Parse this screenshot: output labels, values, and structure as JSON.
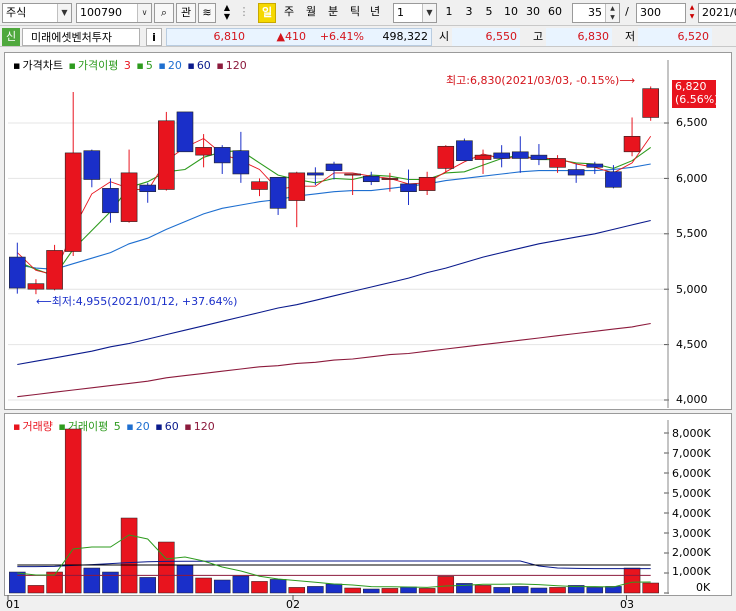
{
  "toolbar": {
    "market": "주식",
    "code": "100790",
    "btn_search": "🔍",
    "btn_watch": "관",
    "period_active": "일",
    "periods": [
      "주",
      "월",
      "분",
      "틱",
      "년"
    ],
    "unit_select": "1",
    "quick_counts": [
      "1",
      "3",
      "5",
      "10",
      "30",
      "60"
    ],
    "view_count": "35",
    "slash": "/",
    "total_count": "300",
    "date": "2021/0"
  },
  "info": {
    "credit_badge": "신",
    "company": "미래에셋벤처투자",
    "info_icon": "i",
    "price": "6,810",
    "change": "▲410",
    "change_pct": "+6.41%",
    "volume": "498,322",
    "open_label": "시",
    "open": "6,550",
    "high_label": "고",
    "high": "6,830",
    "low_label": "저",
    "low": "6,520"
  },
  "price_legend": {
    "title": "가격차트",
    "ma_name": "가격이평",
    "periods": [
      "3",
      "5",
      "20",
      "60",
      "120"
    ]
  },
  "volume_legend": {
    "title": "거래량",
    "ma_name": "거래이평",
    "periods": [
      "5",
      "20",
      "60",
      "120"
    ]
  },
  "annotations": {
    "max": "최고:6,830(2021/03/03, -0.15%)",
    "min": "최저:4,955(2021/01/12, +37.64%)",
    "last_price": "6,820",
    "last_pct": "(6.56%)"
  },
  "price_axis": [
    "6,500",
    "6,000",
    "5,500",
    "5,000",
    "4,500",
    "4,000"
  ],
  "volume_axis": [
    "8,000K",
    "7,000K",
    "6,000K",
    "5,000K",
    "4,000K",
    "3,000K",
    "2,000K",
    "1,000K",
    "0K"
  ],
  "x_axis": [
    "01",
    "02",
    "03"
  ],
  "colors": {
    "up": "#e8141e",
    "down": "#1a2fc9",
    "ma3": "#e8141e",
    "ma5": "#2e9b1e",
    "ma20": "#1e6fd0",
    "ma60": "#0a1a8c",
    "ma120": "#8c1a3c"
  },
  "chart_data": {
    "type": "candlestick",
    "y_range": [
      3900,
      6900
    ],
    "candles": [
      {
        "o": 5290,
        "h": 5420,
        "l": 4960,
        "c": 5010
      },
      {
        "o": 5000,
        "h": 5090,
        "l": 4955,
        "c": 5050
      },
      {
        "o": 5000,
        "h": 5400,
        "l": 4990,
        "c": 5350
      },
      {
        "o": 5340,
        "h": 6780,
        "l": 5300,
        "c": 6230
      },
      {
        "o": 6250,
        "h": 6260,
        "l": 5920,
        "c": 5990
      },
      {
        "o": 5910,
        "h": 6000,
        "l": 5600,
        "c": 5690
      },
      {
        "o": 5610,
        "h": 6260,
        "l": 5600,
        "c": 6050
      },
      {
        "o": 5940,
        "h": 5960,
        "l": 5780,
        "c": 5880
      },
      {
        "o": 5900,
        "h": 6600,
        "l": 5890,
        "c": 6520
      },
      {
        "o": 6600,
        "h": 6600,
        "l": 6240,
        "c": 6240
      },
      {
        "o": 6210,
        "h": 6400,
        "l": 6100,
        "c": 6280
      },
      {
        "o": 6280,
        "h": 6300,
        "l": 6040,
        "c": 6140
      },
      {
        "o": 6250,
        "h": 6420,
        "l": 5960,
        "c": 6040
      },
      {
        "o": 5900,
        "h": 6000,
        "l": 5840,
        "c": 5970
      },
      {
        "o": 6010,
        "h": 6010,
        "l": 5670,
        "c": 5730
      },
      {
        "o": 5800,
        "h": 6060,
        "l": 5560,
        "c": 6050
      },
      {
        "o": 6050,
        "h": 6100,
        "l": 5940,
        "c": 6030
      },
      {
        "o": 6130,
        "h": 6150,
        "l": 5990,
        "c": 6070
      },
      {
        "o": 6040,
        "h": 6040,
        "l": 5850,
        "c": 6040
      },
      {
        "o": 6020,
        "h": 6060,
        "l": 5940,
        "c": 5970
      },
      {
        "o": 5990,
        "h": 6050,
        "l": 5880,
        "c": 6000
      },
      {
        "o": 5950,
        "h": 6080,
        "l": 5760,
        "c": 5880
      },
      {
        "o": 5890,
        "h": 6060,
        "l": 5850,
        "c": 6010
      },
      {
        "o": 6090,
        "h": 6300,
        "l": 6050,
        "c": 6290
      },
      {
        "o": 6340,
        "h": 6360,
        "l": 6160,
        "c": 6160
      },
      {
        "o": 6170,
        "h": 6260,
        "l": 6040,
        "c": 6210
      },
      {
        "o": 6230,
        "h": 6300,
        "l": 6100,
        "c": 6180
      },
      {
        "o": 6240,
        "h": 6380,
        "l": 6050,
        "c": 6180
      },
      {
        "o": 6210,
        "h": 6310,
        "l": 6120,
        "c": 6170
      },
      {
        "o": 6100,
        "h": 6210,
        "l": 6050,
        "c": 6180
      },
      {
        "o": 6080,
        "h": 6130,
        "l": 5960,
        "c": 6030
      },
      {
        "o": 6130,
        "h": 6150,
        "l": 6040,
        "c": 6100
      },
      {
        "o": 6060,
        "h": 6120,
        "l": 5910,
        "c": 5920
      },
      {
        "o": 6240,
        "h": 6550,
        "l": 6200,
        "c": 6380
      },
      {
        "o": 6550,
        "h": 6830,
        "l": 6520,
        "c": 6810
      }
    ],
    "ma3": [
      5330,
      5170,
      5130,
      5540,
      5860,
      5970,
      5910,
      5890,
      6160,
      6280,
      6360,
      6220,
      6160,
      6080,
      5900,
      5930,
      5930,
      6050,
      6050,
      6020,
      6000,
      5950,
      5960,
      6060,
      6150,
      6220,
      6180,
      6190,
      6180,
      6180,
      6130,
      6100,
      6050,
      6140,
      6380
    ],
    "ma5": [
      5250,
      5180,
      5120,
      5360,
      5530,
      5700,
      5920,
      5970,
      6060,
      6080,
      6190,
      6240,
      6250,
      6140,
      6030,
      5990,
      5960,
      6000,
      5990,
      6030,
      6020,
      5990,
      5990,
      6050,
      6060,
      6120,
      6180,
      6210,
      6170,
      6170,
      6140,
      6130,
      6090,
      6160,
      6280
    ],
    "ma20": [
      5220,
      5190,
      5180,
      5230,
      5280,
      5330,
      5410,
      5460,
      5540,
      5610,
      5680,
      5730,
      5760,
      5790,
      5810,
      5840,
      5860,
      5880,
      5890,
      5890,
      5910,
      5930,
      5950,
      5980,
      6000,
      6020,
      6040,
      6060,
      6070,
      6070,
      6070,
      6070,
      6080,
      6100,
      6130
    ],
    "ma60": [
      4320,
      4350,
      4380,
      4410,
      4440,
      4480,
      4510,
      4550,
      4590,
      4630,
      4670,
      4710,
      4750,
      4790,
      4830,
      4860,
      4900,
      4940,
      4980,
      5020,
      5060,
      5100,
      5150,
      5190,
      5240,
      5290,
      5330,
      5370,
      5410,
      5440,
      5470,
      5500,
      5540,
      5580,
      5620
    ],
    "ma120": [
      4030,
      4050,
      4070,
      4090,
      4110,
      4130,
      4150,
      4170,
      4200,
      4220,
      4240,
      4260,
      4280,
      4300,
      4310,
      4330,
      4340,
      4360,
      4370,
      4390,
      4410,
      4420,
      4440,
      4460,
      4480,
      4500,
      4520,
      4540,
      4560,
      4580,
      4600,
      4620,
      4640,
      4660,
      4690
    ],
    "volume": [
      1050,
      380,
      1050,
      8200,
      1250,
      1050,
      3750,
      780,
      2550,
      1400,
      750,
      650,
      850,
      580,
      680,
      280,
      330,
      450,
      250,
      200,
      230,
      300,
      230,
      830,
      480,
      380,
      280,
      330,
      250,
      280,
      380,
      280,
      330,
      1250,
      500
    ],
    "vol_ma5": [
      1000,
      900,
      900,
      2200,
      2300,
      2300,
      2900,
      2700,
      1700,
      1800,
      1600,
      1300,
      1100,
      840,
      700,
      620,
      540,
      450,
      400,
      320,
      310,
      300,
      280,
      350,
      380,
      440,
      440,
      450,
      420,
      360,
      320,
      320,
      300,
      540,
      550
    ],
    "vol_ma20": [
      1400,
      1400,
      1400,
      1400,
      1400,
      1400,
      1400,
      1400,
      1400,
      1400,
      1400,
      1400,
      1400,
      1400,
      1400,
      1400,
      1400,
      1400,
      1400,
      1400,
      1400,
      1400,
      1400,
      1400,
      1400,
      1400,
      1400,
      1400,
      1400,
      1400,
      1400,
      1400,
      1400,
      1400,
      1400
    ],
    "vol_ma60": [
      1320,
      1320,
      1330,
      1380,
      1420,
      1470,
      1520,
      1560,
      1580,
      1590,
      1590,
      1600,
      1600,
      1600,
      1600,
      1600,
      1600,
      1600,
      1600,
      1600,
      1600,
      1600,
      1600,
      1600,
      1600,
      1600,
      1600,
      1600,
      1350,
      1250,
      1230,
      1220,
      1220,
      1220,
      1220
    ],
    "vol_ma120": [
      880,
      880,
      880,
      880,
      880,
      880,
      880,
      880,
      880,
      880,
      880,
      880,
      880,
      880,
      880,
      880,
      880,
      880,
      880,
      880,
      880,
      880,
      880,
      880,
      880,
      880,
      880,
      880,
      880,
      880,
      880,
      880,
      880,
      880,
      880
    ],
    "vol_range": [
      0,
      8300
    ]
  }
}
